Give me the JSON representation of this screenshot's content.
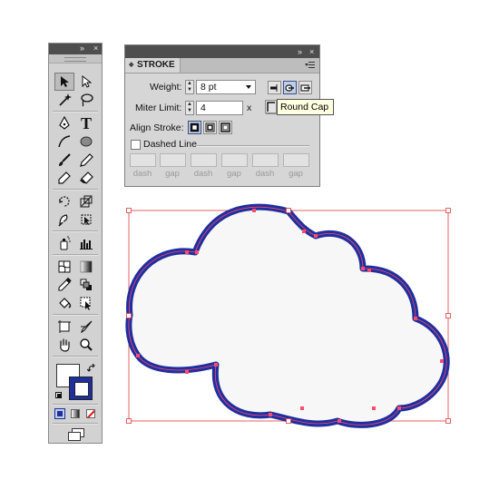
{
  "tools_panel": {
    "header_icons": [
      "double-arrow-icon",
      "close-icon"
    ],
    "header_glyphs": {
      "collapse": "»",
      "close": "×"
    },
    "tools": [
      "selection-tool-icon",
      "direct-selection-tool-icon",
      "magic-wand-tool-icon",
      "lasso-tool-icon",
      "pen-tool-icon",
      "type-tool-icon",
      "line-segment-tool-icon",
      "ellipse-tool-icon",
      "paintbrush-tool-icon",
      "pencil-tool-icon",
      "blob-brush-tool-icon",
      "eraser-tool-icon",
      "rotate-tool-icon",
      "scale-tool-icon",
      "warp-tool-icon",
      "free-transform-tool-icon",
      "symbol-sprayer-tool-icon",
      "column-graph-tool-icon",
      "mesh-tool-icon",
      "gradient-tool-icon",
      "eyedropper-tool-icon",
      "blend-tool-icon",
      "live-paint-bucket-tool-icon",
      "live-paint-selection-tool-icon",
      "artboard-tool-icon",
      "slice-tool-icon",
      "hand-tool-icon",
      "zoom-tool-icon"
    ],
    "type_tool_glyph": "T",
    "fill_color": "#ffffff",
    "stroke_color": "#1f2f9e",
    "color_modes": [
      "color-mode-icon",
      "gradient-mode-icon",
      "none-mode-icon"
    ],
    "screen_mode_icon": "screen-mode-icon"
  },
  "stroke_panel": {
    "tab_title": "STROKE",
    "tab_prefix": "◆",
    "menu_icon": "panel-menu-icon",
    "header_glyphs": {
      "collapse": "»",
      "close": "×"
    },
    "weight_label": "Weight:",
    "weight_value": "8 pt",
    "miter_label": "Miter Limit:",
    "miter_value": "4",
    "miter_unit": "x",
    "align_label": "Align Stroke:",
    "dashed_label": "Dashed Line",
    "dashed_checked": false,
    "dash_labels": [
      "dash",
      "gap",
      "dash",
      "gap",
      "dash",
      "gap"
    ],
    "cap_buttons": [
      "butt-cap-icon",
      "round-cap-icon",
      "projecting-cap-icon"
    ],
    "selected_cap": "round-cap-icon",
    "join_buttons": [
      "miter-join-icon",
      "round-join-icon",
      "bevel-join-icon"
    ],
    "align_buttons": [
      "align-center-icon",
      "align-inside-icon",
      "align-outside-icon"
    ],
    "selected_align": "align-center-icon"
  },
  "tooltip": "Round Cap",
  "artwork": {
    "shape": "cloud",
    "fill": "#f7f7f7",
    "stroke": "#1f2f9e",
    "path_color": "#ff4b6e",
    "bbox_color": "#e23b3b"
  }
}
